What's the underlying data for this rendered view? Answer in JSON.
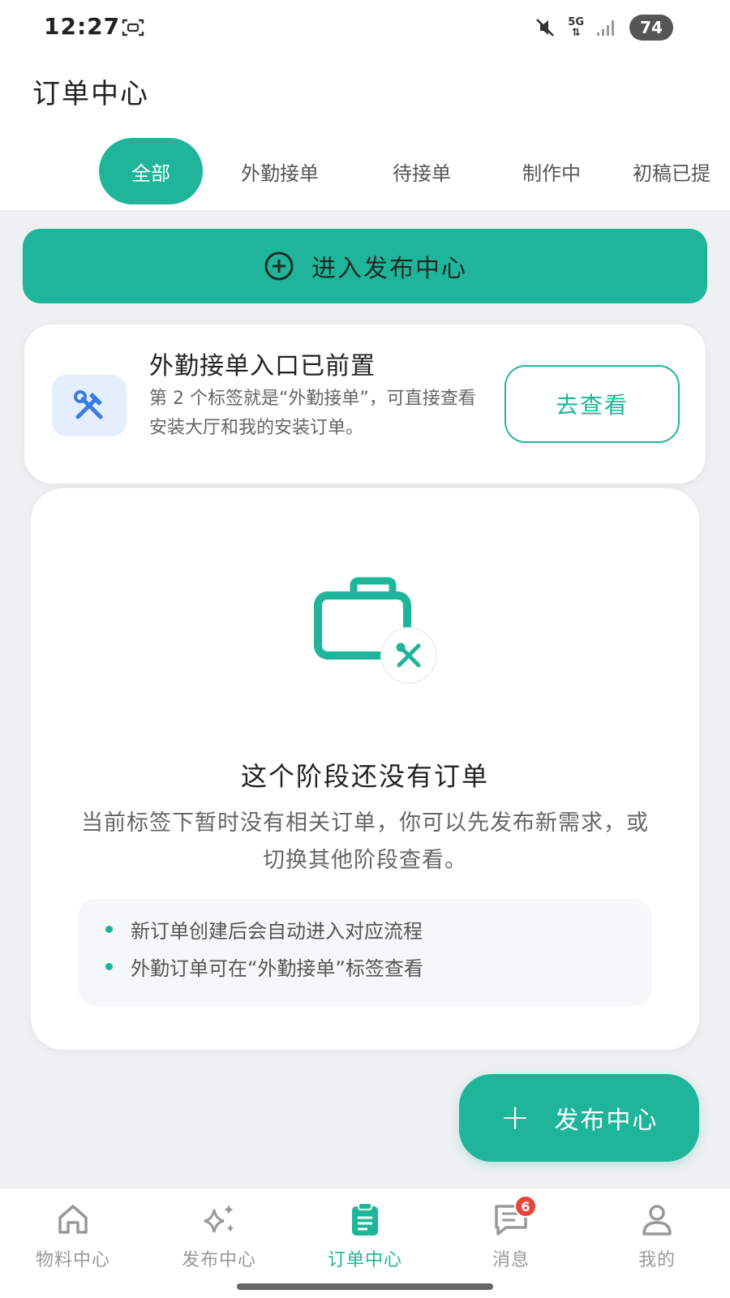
{
  "status_bar": {
    "time": "12:27",
    "network": "5G",
    "battery": "74",
    "icons": [
      "screenshot-icon",
      "mute-icon",
      "signal-icon"
    ]
  },
  "header": {
    "title": "订单中心"
  },
  "tabs": [
    {
      "label": "全部",
      "active": true
    },
    {
      "label": "外勤接单",
      "active": false
    },
    {
      "label": "待接单",
      "active": false
    },
    {
      "label": "制作中",
      "active": false
    },
    {
      "label": "初稿已提",
      "active": false
    }
  ],
  "publish_banner": {
    "label": "进入发布中心",
    "icon": "plus-circle-icon"
  },
  "info_card": {
    "title": "外勤接单入口已前置",
    "description": "第 2 个标签就是“外勤接单”，可直接查看安装大厅和我的安装订单。",
    "button_label": "去查看",
    "icon": "tools-icon"
  },
  "empty_state": {
    "title": "这个阶段还没有订单",
    "description": "当前标签下暂时没有相关订单，你可以先发布新需求，或切换其他阶段查看。",
    "icon": "briefcase-icon",
    "tips": [
      "新订单创建后会自动进入对应流程",
      "外勤订单可在“外勤接单”标签查看"
    ]
  },
  "fab": {
    "label": "发布中心",
    "icon": "plus-icon"
  },
  "bottom_nav": {
    "items": [
      {
        "label": "物料中心",
        "icon": "home-icon",
        "active": false
      },
      {
        "label": "发布中心",
        "icon": "sparkle-icon",
        "active": false
      },
      {
        "label": "订单中心",
        "icon": "clipboard-icon",
        "active": true
      },
      {
        "label": "消息",
        "icon": "chat-icon",
        "active": false,
        "badge": "6"
      },
      {
        "label": "我的",
        "icon": "user-icon",
        "active": false
      }
    ]
  },
  "colors": {
    "accent": "#1fb59a",
    "background": "#eef0f2",
    "badge": "#e8453c",
    "info_icon_bg": "#e4eefc"
  }
}
